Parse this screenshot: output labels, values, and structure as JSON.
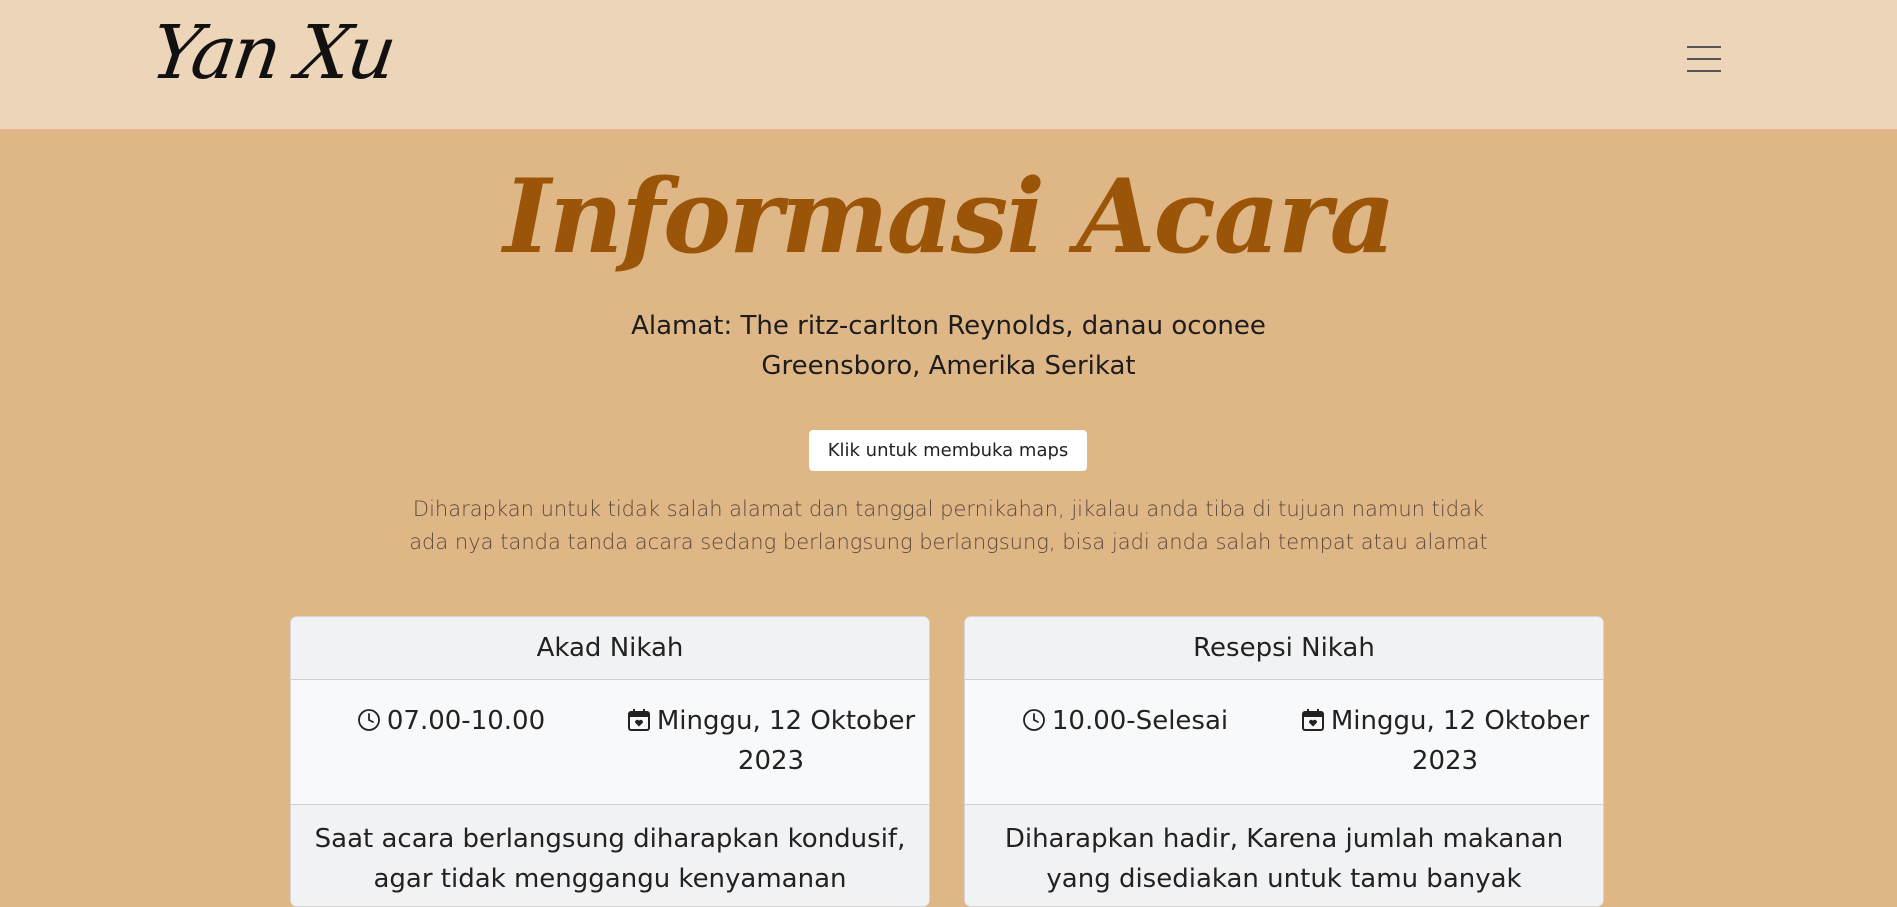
{
  "navbar": {
    "brand": "Yan Xu",
    "menu_icon": "hamburger-menu-icon"
  },
  "section": {
    "title": "Informasi Acara",
    "address_line1": "Alamat: The ritz-carlton Reynolds, danau oconee",
    "address_line2": "Greensboro, Amerika Serikat",
    "maps_button": "Klik untuk membuka maps",
    "note_line1": "Diharapkan untuk tidak salah alamat dan tanggal pernikahan, jikalau anda tiba di tujuan namun tidak",
    "note_line2": "ada nya tanda tanda acara sedang berlangsung berlangsung, bisa jadi anda salah tempat atau alamat"
  },
  "cards": [
    {
      "title": "Akad Nikah",
      "time": "07.00-10.00",
      "date_line1": "Minggu, 12 Oktober",
      "date_line2": "2023",
      "footer_line1": "Saat acara berlangsung diharapkan kondusif,",
      "footer_line2": "agar tidak menggangu kenyamanan",
      "time_icon": "clock-icon",
      "date_icon": "calendar-heart-icon"
    },
    {
      "title": "Resepsi Nikah",
      "time": "10.00-Selesai",
      "date_line1": "Minggu, 12 Oktober",
      "date_line2": "2023",
      "footer_line1": "Diharapkan hadir, Karena jumlah makanan",
      "footer_line2": "yang disediakan untuk tamu banyak",
      "time_icon": "clock-icon",
      "date_icon": "calendar-heart-icon"
    }
  ],
  "colors": {
    "page_background": "#dfb686",
    "navbar_background": "#edd5b9",
    "title_color": "#9b5508"
  }
}
